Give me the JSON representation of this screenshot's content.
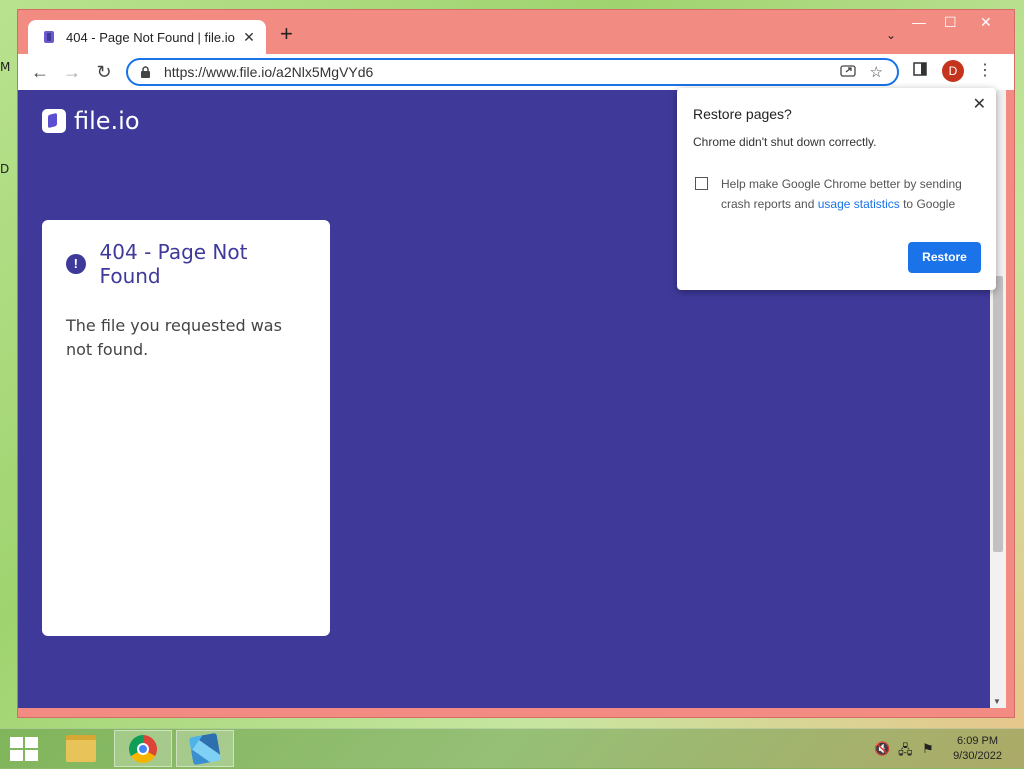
{
  "desktop": {
    "glyph_top": "M",
    "glyph_mid": "D"
  },
  "browser": {
    "tab": {
      "title": "404 - Page Not Found | file.io",
      "close": "✕"
    },
    "new_tab": "+",
    "controls": {
      "minimize": "—",
      "maximize": "☐",
      "close": "✕",
      "tab_search": "⌄"
    },
    "nav": {
      "back": "←",
      "forward": "→",
      "reload": "↻"
    },
    "url": "https://www.file.io/a2Nlx5MgVYd6",
    "avatar_letter": "D",
    "menu": "⋮"
  },
  "page": {
    "logo_text": "file.io",
    "card": {
      "alert": "!",
      "title": "404 - Page Not Found",
      "message": "The file you requested was not found."
    },
    "bg_color": "#3f3a9a"
  },
  "popup": {
    "title": "Restore pages?",
    "close": "✕",
    "subtitle": "Chrome didn't shut down correctly.",
    "checkbox_text_pre": "Help make Google Chrome better by sending crash reports and ",
    "checkbox_link": "usage statistics",
    "checkbox_text_post": " to Google",
    "checkbox_checked": false,
    "restore_label": "Restore"
  },
  "taskbar": {
    "time": "6:09 PM",
    "date": "9/30/2022"
  },
  "colors": {
    "accent": "#1a73e8",
    "window_frame": "#f28b82",
    "avatar": "#c5341d"
  }
}
